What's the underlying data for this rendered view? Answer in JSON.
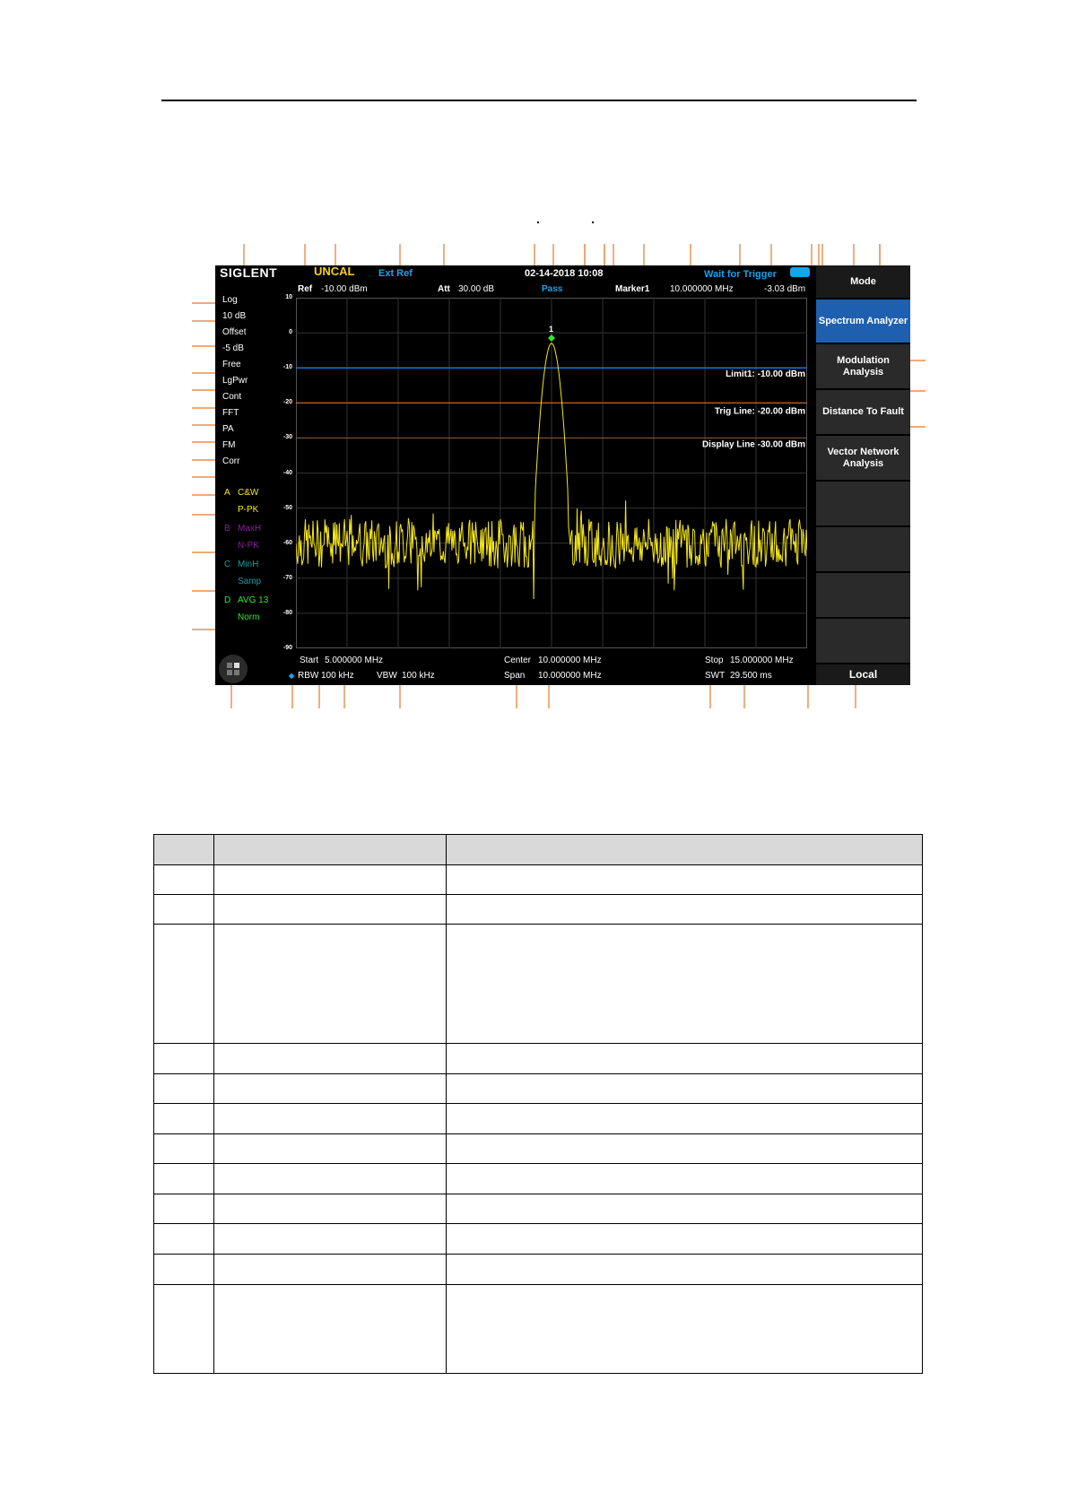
{
  "screen": {
    "logo": "SIGLENT",
    "uncal": "UNCAL",
    "ext_ref": "Ext Ref",
    "datetime": "02-14-2018 10:08",
    "trigger_status": "Wait for Trigger",
    "ref_label": "Ref",
    "ref_value": "-10.00 dBm",
    "att_label": "Att",
    "att_value": "30.00 dB",
    "pass": "Pass",
    "marker_label": "Marker1",
    "marker_freq": "10.000000 MHz",
    "marker_level": "-3.03 dBm",
    "left_panel": [
      "Log",
      "10 dB",
      "Offset",
      "-5 dB",
      "Free",
      "LgPwr",
      "Cont",
      "FFT",
      "PA",
      "FM",
      "Corr"
    ],
    "traces": [
      {
        "letter": "A",
        "mode": "C&W",
        "detector": "P-PK",
        "color": "#f5e61a"
      },
      {
        "letter": "B",
        "mode": "MaxH",
        "detector": "N-PK",
        "color": "#8a1fa3"
      },
      {
        "letter": "C",
        "mode": "MinH",
        "detector": "Samp",
        "color": "#1a9aa3"
      },
      {
        "letter": "D",
        "mode": "AVG 13",
        "detector": "Norm",
        "color": "#2ee62e"
      }
    ],
    "y_ticks": [
      "10",
      "0",
      "-10",
      "-20",
      "-30",
      "-40",
      "-50",
      "-60",
      "-70",
      "-80",
      "-90"
    ],
    "limit_label": "Limit1: -10.00 dBm",
    "trig_label": "Trig Line: -20.00 dBm",
    "display_label": "Display Line -30.00 dBm",
    "marker_number": "1",
    "start_label": "Start",
    "start_value": "5.000000 MHz",
    "center_label": "Center",
    "center_value": "10.000000 MHz",
    "stop_label": "Stop",
    "stop_value": "15.000000 MHz",
    "rbw_label": "RBW",
    "rbw_value": "100 kHz",
    "vbw_label": "VBW",
    "vbw_value": "100 kHz",
    "span_label": "Span",
    "span_value": "10.000000 MHz",
    "swt_label": "SWT",
    "swt_value": "29.500 ms",
    "softkeys": {
      "mode": "Mode",
      "spectrum": "Spectrum Analyzer",
      "modulation": "Modulation Analysis",
      "dtf": "Distance To Fault",
      "vna": "Vector Network Analysis",
      "local": "Local"
    },
    "colors": {
      "trace": "#f5e61a",
      "limit_line": "#1a73d9",
      "trig_line": "#e8782a",
      "display_line": "#8a5a3a",
      "marker": "#2ee62e",
      "callout": "#e8782a"
    }
  },
  "chart_data": {
    "type": "line",
    "ylim": [
      -90,
      10
    ],
    "xlim": [
      5,
      15
    ],
    "xlabel": "",
    "ylabel": "",
    "limit_line_dbm": -10,
    "trig_line_dbm": -20,
    "display_line_dbm": -30,
    "marker": {
      "x_mhz": 10.0,
      "y_dbm": -3.03
    },
    "noise_floor_dbm": -60,
    "peak_dbm": -3
  }
}
